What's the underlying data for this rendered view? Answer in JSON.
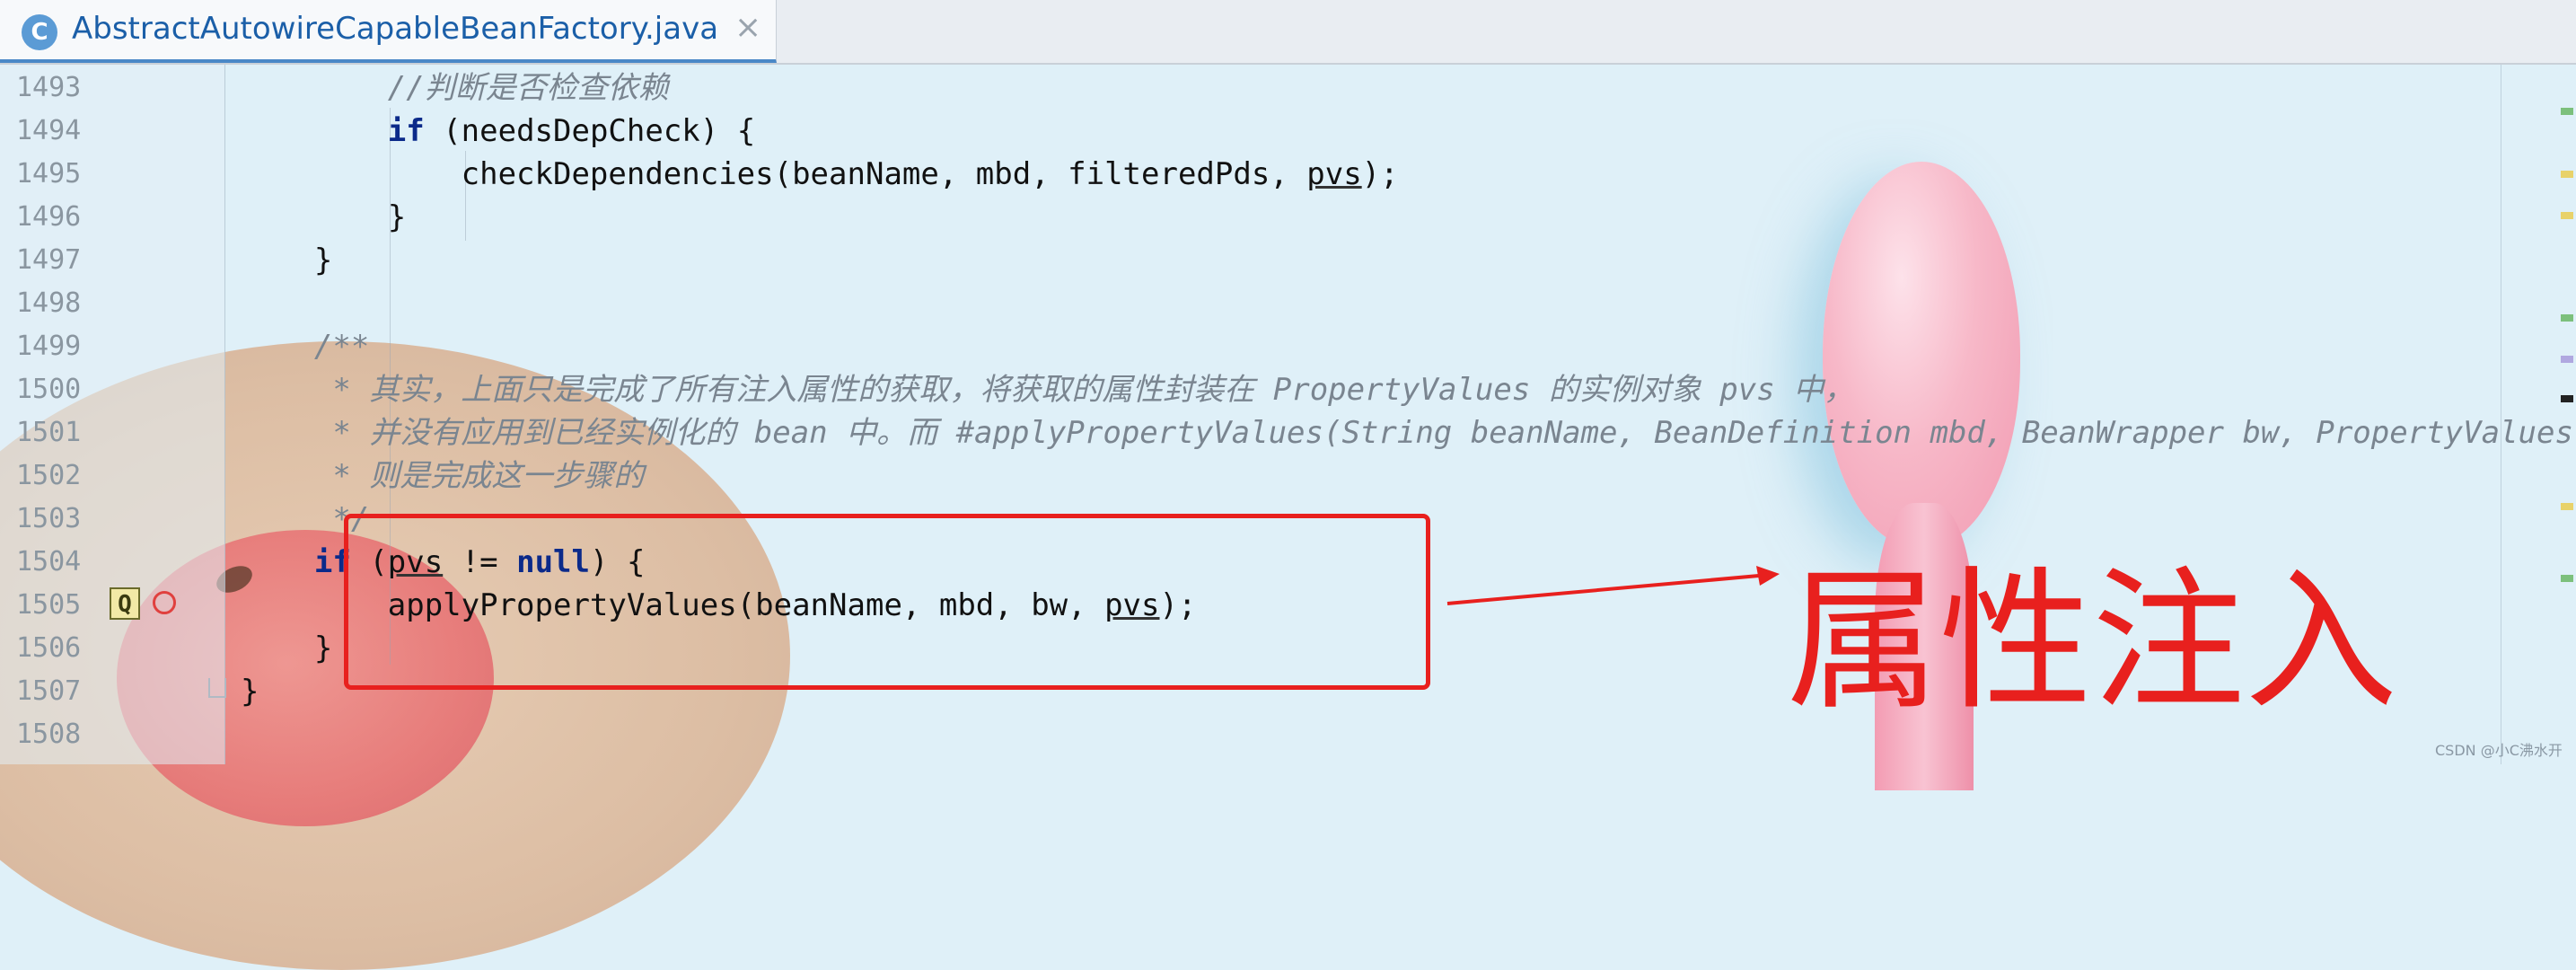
{
  "tab": {
    "icon_letter": "C",
    "filename": "AbstractAutowireCapableBeanFactory.java",
    "close": "×"
  },
  "lines": [
    {
      "num": "1493",
      "parts": [
        {
          "t": "        "
        },
        {
          "t": "//判断是否检查依赖",
          "c": "cm"
        }
      ]
    },
    {
      "num": "1494",
      "parts": [
        {
          "t": "        "
        },
        {
          "t": "if",
          "c": "kw"
        },
        {
          "t": " (needsDepCheck) {"
        }
      ]
    },
    {
      "num": "1495",
      "parts": [
        {
          "t": "            checkDependencies(beanName, mbd, filteredPds, "
        },
        {
          "t": "pvs",
          "c": "ul"
        },
        {
          "t": ");"
        }
      ]
    },
    {
      "num": "1496",
      "parts": [
        {
          "t": "        }"
        }
      ]
    },
    {
      "num": "1497",
      "parts": [
        {
          "t": "    }"
        }
      ]
    },
    {
      "num": "1498",
      "parts": []
    },
    {
      "num": "1499",
      "parts": [
        {
          "t": "    "
        },
        {
          "t": "/**",
          "c": "cm"
        }
      ]
    },
    {
      "num": "1500",
      "parts": [
        {
          "t": "     "
        },
        {
          "t": "* 其实，上面只是完成了所有注入属性的获取，将获取的属性封装在 PropertyValues 的实例对象 pvs 中，",
          "c": "cm"
        }
      ]
    },
    {
      "num": "1501",
      "parts": [
        {
          "t": "     "
        },
        {
          "t": "* 并没有应用到已经实例化的 bean 中。而 #applyPropertyValues(String beanName, BeanDefinition mbd, BeanWrapper bw, PropertyValues pvs)",
          "c": "cm"
        }
      ]
    },
    {
      "num": "1502",
      "parts": [
        {
          "t": "     "
        },
        {
          "t": "* 则是完成这一步骤的",
          "c": "cm"
        }
      ]
    },
    {
      "num": "1503",
      "parts": [
        {
          "t": "     "
        },
        {
          "t": "*/",
          "c": "cm"
        }
      ]
    },
    {
      "num": "1504",
      "parts": [
        {
          "t": "    "
        },
        {
          "t": "if",
          "c": "kw"
        },
        {
          "t": " ("
        },
        {
          "t": "pvs",
          "c": "ul"
        },
        {
          "t": " != "
        },
        {
          "t": "null",
          "c": "kw"
        },
        {
          "t": ") {"
        }
      ]
    },
    {
      "num": "1505",
      "parts": [
        {
          "t": "        applyPropertyValues(beanName, mbd, bw, "
        },
        {
          "t": "pvs",
          "c": "ul"
        },
        {
          "t": ");"
        }
      ]
    },
    {
      "num": "1506",
      "parts": [
        {
          "t": "    }"
        }
      ]
    },
    {
      "num": "1507",
      "parts": [
        {
          "t": "}"
        }
      ]
    },
    {
      "num": "1508",
      "parts": []
    }
  ],
  "gutter": {
    "quick_icon": "Q"
  },
  "annotation": {
    "label": "属性注入",
    "color": "#e8201e"
  },
  "watermark": "CSDN @小C沸水开"
}
